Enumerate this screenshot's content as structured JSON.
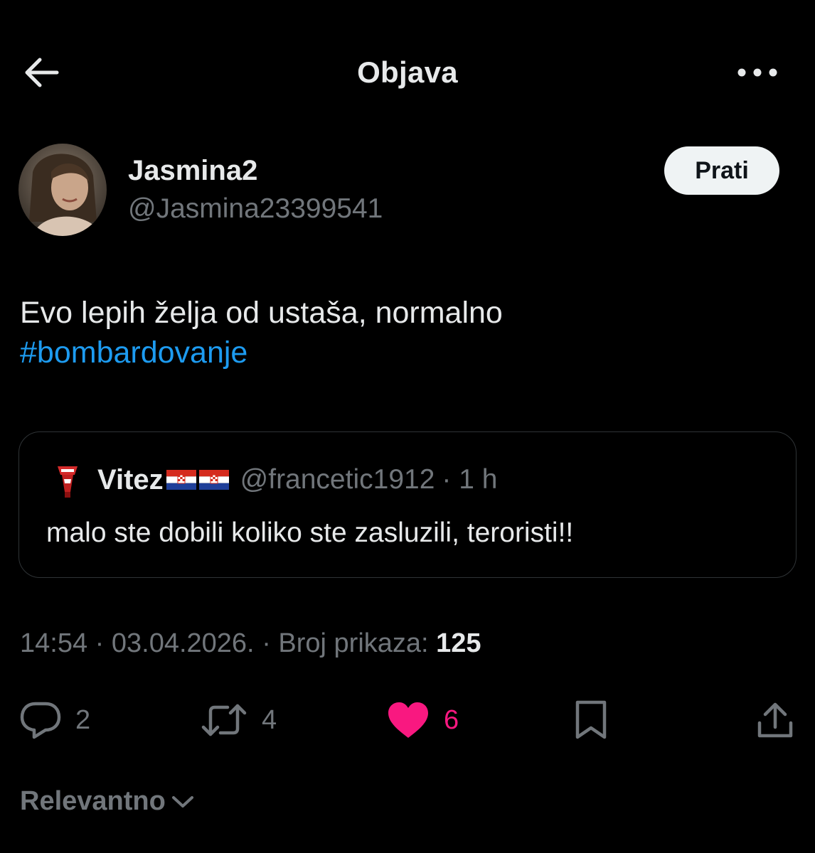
{
  "header": {
    "title": "Objava",
    "back_icon": "arrow-left-icon",
    "more_icon": "more-horizontal-icon"
  },
  "author": {
    "name": "Jasmina2",
    "handle": "@Jasmina23399541",
    "follow_label": "Prati"
  },
  "post": {
    "text": "Evo lepih želja od ustaša, normalno",
    "hashtag": "#bombardovanje"
  },
  "quoted": {
    "name": "Vitez",
    "handle": "@francetic1912",
    "time": "· 1 h",
    "text": "malo ste dobili koliko ste zasluzili, teroristi!!"
  },
  "meta": {
    "time": "14:54",
    "date": "· 03.04.2026.",
    "views_label": "· Broj prikaza:",
    "views_count": "125"
  },
  "actions": {
    "replies": "2",
    "reposts": "4",
    "likes": "6"
  },
  "sort": {
    "label": "Relevantno"
  },
  "colors": {
    "background": "#000000",
    "text": "#e7e9ea",
    "secondary": "#71767b",
    "link": "#1d9bf0",
    "like": "#f91880",
    "border": "#2f3336"
  }
}
